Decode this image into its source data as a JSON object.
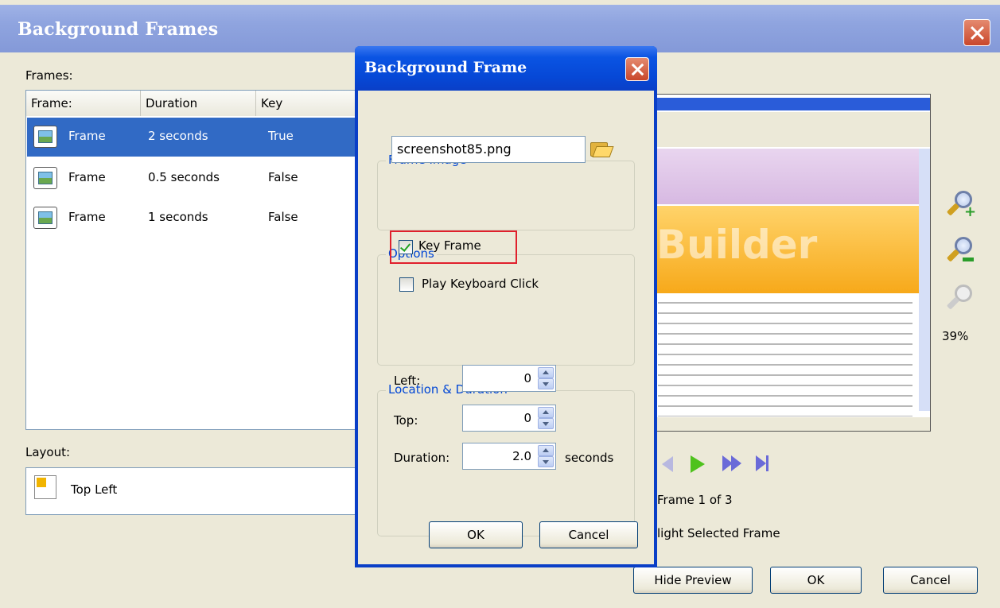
{
  "outer": {
    "title": "Background Frames",
    "frames_label": "Frames:",
    "columns": [
      "Frame:",
      "Duration",
      "Key"
    ],
    "rows": [
      {
        "name": "Frame",
        "duration": "2 seconds",
        "key": "True",
        "selected": true
      },
      {
        "name": "Frame",
        "duration": "0.5 seconds",
        "key": "False",
        "selected": false
      },
      {
        "name": "Frame",
        "duration": "1 seconds",
        "key": "False",
        "selected": false
      }
    ],
    "layout_label": "Layout:",
    "layout_value": "Top Left",
    "zoom_percent": "39%",
    "preview_text": "Builder",
    "frame_counter": "Frame 1 of 3",
    "highlight_label": "light Selected Frame",
    "hide_preview_label": "Hide Preview",
    "ok_label": "OK",
    "cancel_label": "Cancel"
  },
  "dialog": {
    "title": "Background Frame",
    "frame_image_group": "Frame Image",
    "image_file": "screenshot85.png",
    "options_group": "Options",
    "key_frame_label": "Key Frame",
    "key_frame_checked": true,
    "play_click_label": "Play Keyboard Click",
    "play_click_checked": false,
    "location_group": "Location & Duration",
    "left_label": "Left:",
    "left_value": "0",
    "top_label": "Top:",
    "top_value": "0",
    "duration_label": "Duration:",
    "duration_value": "2.0",
    "seconds_label": "seconds",
    "ok_label": "OK",
    "cancel_label": "Cancel"
  },
  "colors": {
    "selection": "#316ac5",
    "highlight_border": "#e0202c",
    "group_title": "#0046d5"
  }
}
